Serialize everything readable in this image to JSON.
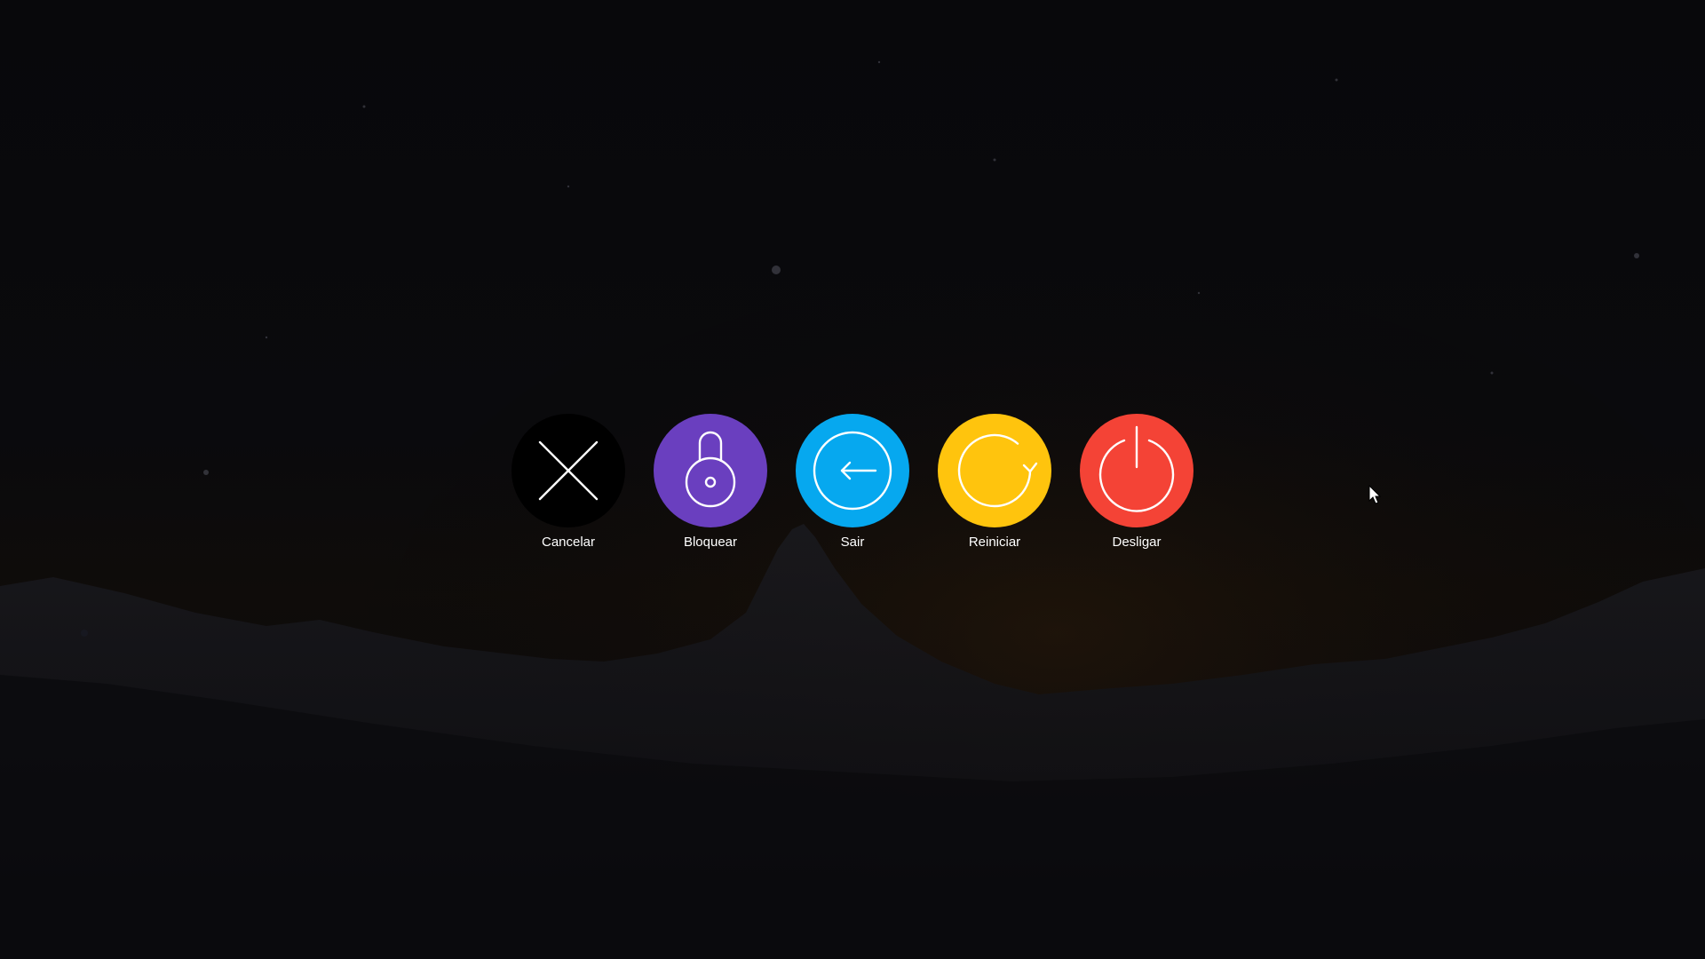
{
  "colors": {
    "cancel": "#000000",
    "lock": "#6a3fbf",
    "logout": "#06a8ef",
    "restart": "#ffc40d",
    "shutdown": "#f44336",
    "icon_stroke": "#ffffff",
    "label": "#ffffff"
  },
  "actions": [
    {
      "id": "cancel",
      "label": "Cancelar",
      "icon": "close-icon"
    },
    {
      "id": "lock",
      "label": "Bloquear",
      "icon": "lock-icon"
    },
    {
      "id": "logout",
      "label": "Sair",
      "icon": "logout-arrow-icon"
    },
    {
      "id": "restart",
      "label": "Reiniciar",
      "icon": "restart-icon"
    },
    {
      "id": "shutdown",
      "label": "Desligar",
      "icon": "power-icon"
    }
  ]
}
